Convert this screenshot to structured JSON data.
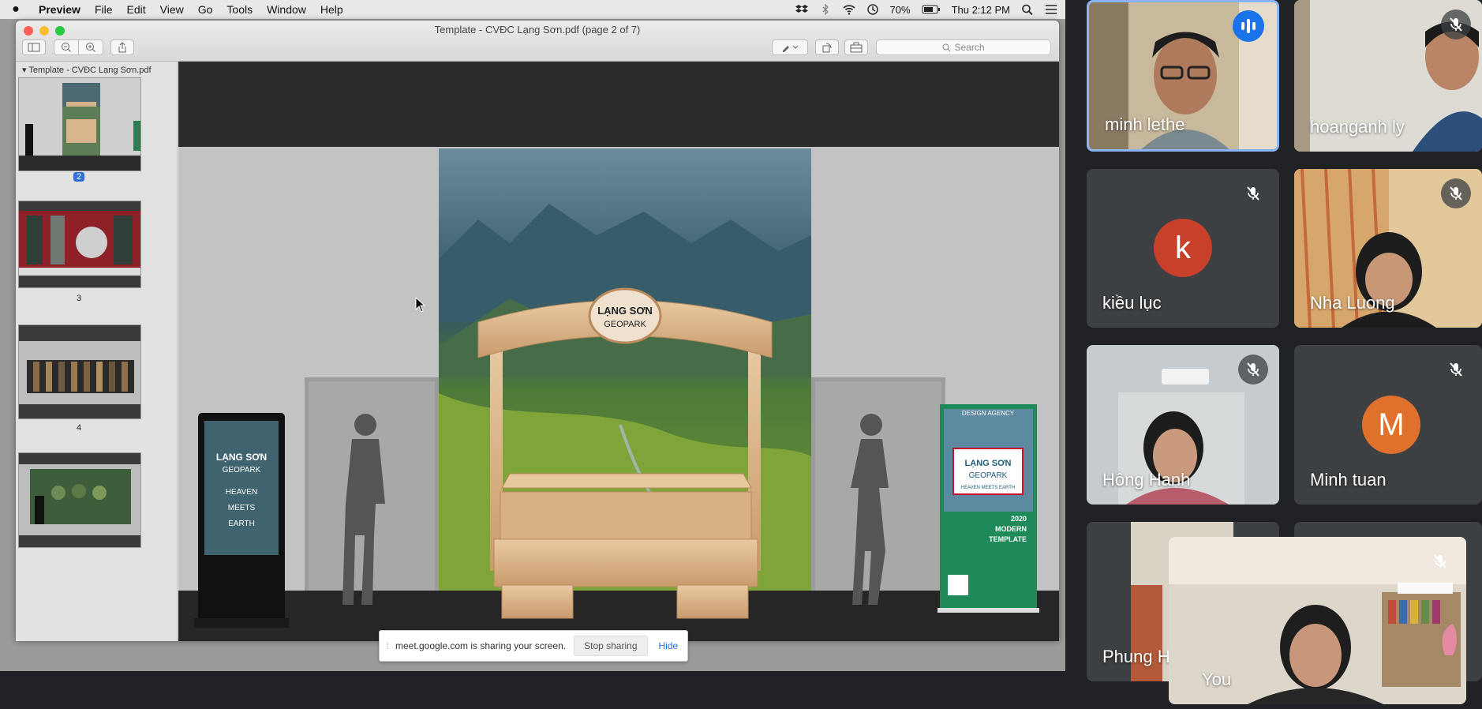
{
  "menubar": {
    "app": "Preview",
    "items": [
      "File",
      "Edit",
      "View",
      "Go",
      "Tools",
      "Window",
      "Help"
    ],
    "battery": "70%",
    "clock": "Thu 2:12 PM"
  },
  "window": {
    "title": "Template - CVĐC Lạng Sơn.pdf (page 2 of 7)",
    "search_placeholder": "Search"
  },
  "sidebar": {
    "header": "Template - CVĐC Lạng Sơn.pdf",
    "pages": [
      "2",
      "3",
      "4"
    ]
  },
  "document": {
    "arch_sign_line1": "LẠNG SƠN",
    "arch_sign_line2": "GEOPARK",
    "kiosk_title": "LẠNG SƠN",
    "kiosk_sub": "GEOPARK",
    "kiosk_tagline": [
      "HEAVEN",
      "MEETS",
      "EARTH"
    ],
    "banner_top": "DESIGN AGENCY",
    "banner_title": "LẠNG SƠN",
    "banner_sub": "GEOPARK",
    "banner_tag": "HEAVEN MEETS EARTH",
    "banner_year": "2020",
    "banner_lines": [
      "MODERN",
      "TEMPLATE"
    ]
  },
  "share_bar": {
    "message": "meet.google.com is sharing your screen.",
    "stop_label": "Stop sharing",
    "hide_label": "Hide"
  },
  "participants": [
    {
      "name": "minh lethe",
      "state": "speaking"
    },
    {
      "name": "hoanganh ly",
      "state": "muted"
    },
    {
      "name": "kiều lục",
      "state": "muted",
      "initial": "k",
      "color": "#c8402a"
    },
    {
      "name": "Nha Luong",
      "state": "muted"
    },
    {
      "name": "Hông Hanh",
      "state": "muted"
    },
    {
      "name": "Minh tuan",
      "state": "muted",
      "initial": "M",
      "color": "#e0712c"
    },
    {
      "name": "Phung H",
      "state": "muted"
    },
    {
      "name": "You",
      "state": "muted"
    }
  ],
  "colors": {
    "meet_bg": "#202124",
    "tile_bg": "#3c4043",
    "accent": "#1a73e8"
  }
}
